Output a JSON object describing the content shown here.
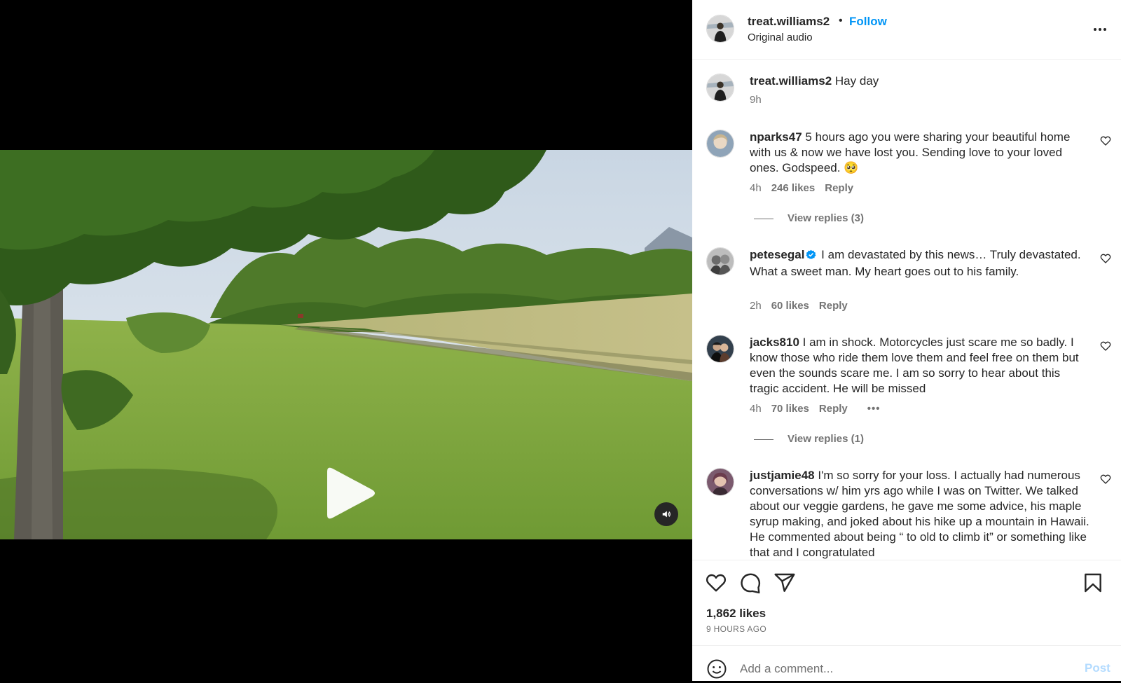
{
  "colors": {
    "link_blue": "#0095f6",
    "muted": "#737373",
    "text": "#262626",
    "post_disabled": "#b3dbff"
  },
  "header": {
    "username": "treat.williams2",
    "separator": "•",
    "follow_label": "Follow",
    "audio": "Original audio",
    "more_icon": "more-horizontal-icon"
  },
  "caption": {
    "username": "treat.williams2",
    "text": "Hay day",
    "time": "9h"
  },
  "comments": [
    {
      "username": "nparks47",
      "text": "5 hours ago you were sharing your beautiful home with us & now we have lost you. Sending love to your loved ones. Godspeed. 🥺",
      "time": "4h",
      "likes": "246 likes",
      "reply": "Reply",
      "view_replies": "View replies (3)"
    },
    {
      "username": "petesegal",
      "verified": true,
      "text": "I am devastated by this news… Truly devastated. What a sweet man. My heart goes out to his family.",
      "time": "2h",
      "likes": "60 likes",
      "reply": "Reply"
    },
    {
      "username": "jacks810",
      "text": "I am in shock. Motorcycles just scare me so badly. I know those who ride them love them and feel free on them but even the sounds scare me. I am so sorry to hear about this tragic accident. He will be missed",
      "time": "4h",
      "likes": "70 likes",
      "reply": "Reply",
      "more": "•••",
      "view_replies": "View replies (1)"
    },
    {
      "username": "justjamie48",
      "text": "I'm so sorry for your loss. I actually had numerous conversations w/ him yrs ago while I was on Twitter. We talked about our veggie gardens, he gave me some advice, his maple syrup making, and joked about his hike up a mountain in Hawaii. He commented about being “ to old to climb it” or something like that and I congratulated"
    }
  ],
  "actions": {
    "icons": [
      "heart-icon",
      "comment-icon",
      "share-icon",
      "bookmark-icon"
    ]
  },
  "likes_count": "1,862 likes",
  "time_ago": "9 HOURS AGO",
  "add_comment": {
    "placeholder": "Add a comment...",
    "post_label": "Post"
  }
}
